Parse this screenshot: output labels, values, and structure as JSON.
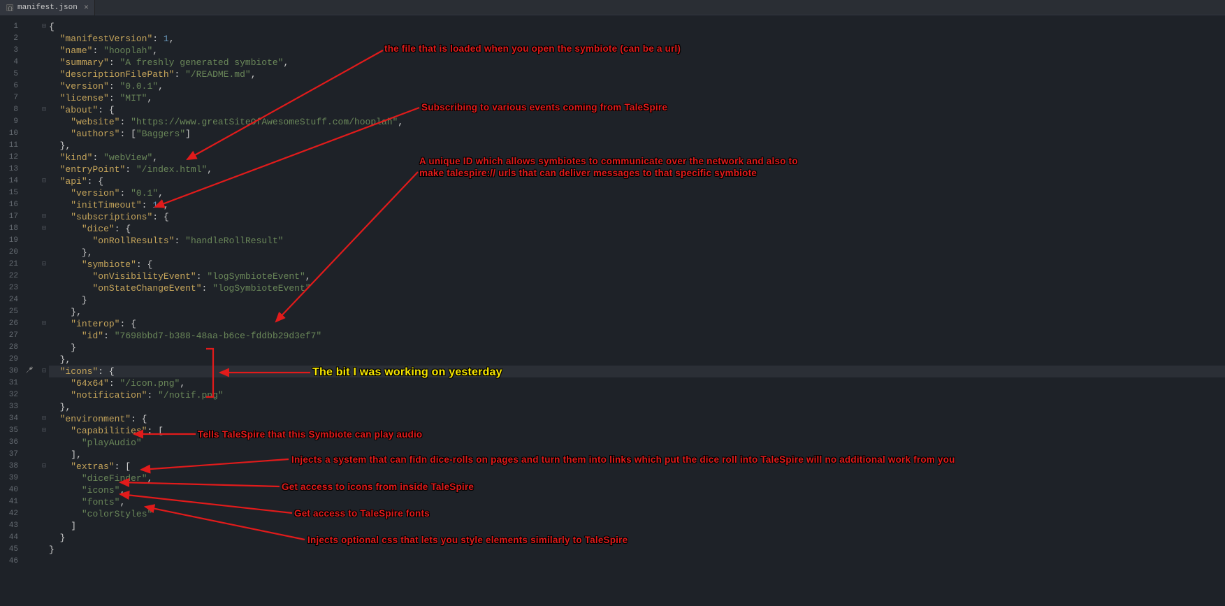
{
  "tab": {
    "filename": "manifest.json"
  },
  "current_line": 30,
  "lines": [
    {
      "n": 1,
      "t": "{"
    },
    {
      "n": 2,
      "t": "  \"manifestVersion\": 1,"
    },
    {
      "n": 3,
      "t": "  \"name\": \"hooplah\","
    },
    {
      "n": 4,
      "t": "  \"summary\": \"A freshly generated symbiote\","
    },
    {
      "n": 5,
      "t": "  \"descriptionFilePath\": \"/README.md\","
    },
    {
      "n": 6,
      "t": "  \"version\": \"0.0.1\","
    },
    {
      "n": 7,
      "t": "  \"license\": \"MIT\","
    },
    {
      "n": 8,
      "t": "  \"about\": {"
    },
    {
      "n": 9,
      "t": "    \"website\": \"https://www.greatSiteOfAwesomeStuff.com/hooplah\","
    },
    {
      "n": 10,
      "t": "    \"authors\": [\"Baggers\"]"
    },
    {
      "n": 11,
      "t": "  },"
    },
    {
      "n": 12,
      "t": "  \"kind\": \"webView\","
    },
    {
      "n": 13,
      "t": "  \"entryPoint\": \"/index.html\","
    },
    {
      "n": 14,
      "t": "  \"api\": {"
    },
    {
      "n": 15,
      "t": "    \"version\": \"0.1\","
    },
    {
      "n": 16,
      "t": "    \"initTimeout\": 10,"
    },
    {
      "n": 17,
      "t": "    \"subscriptions\": {"
    },
    {
      "n": 18,
      "t": "      \"dice\": {"
    },
    {
      "n": 19,
      "t": "        \"onRollResults\": \"handleRollResult\""
    },
    {
      "n": 20,
      "t": "      },"
    },
    {
      "n": 21,
      "t": "      \"symbiote\": {"
    },
    {
      "n": 22,
      "t": "        \"onVisibilityEvent\": \"logSymbioteEvent\","
    },
    {
      "n": 23,
      "t": "        \"onStateChangeEvent\": \"logSymbioteEvent\""
    },
    {
      "n": 24,
      "t": "      }"
    },
    {
      "n": 25,
      "t": "    },"
    },
    {
      "n": 26,
      "t": "    \"interop\": {"
    },
    {
      "n": 27,
      "t": "      \"id\": \"7698bbd7-b388-48aa-b6ce-fddbb29d3ef7\""
    },
    {
      "n": 28,
      "t": "    }"
    },
    {
      "n": 29,
      "t": "  },"
    },
    {
      "n": 30,
      "t": "  \"icons\": {"
    },
    {
      "n": 31,
      "t": "    \"64x64\": \"/icon.png\","
    },
    {
      "n": 32,
      "t": "    \"notification\": \"/notif.png\""
    },
    {
      "n": 33,
      "t": "  },"
    },
    {
      "n": 34,
      "t": "  \"environment\": {"
    },
    {
      "n": 35,
      "t": "    \"capabilities\": ["
    },
    {
      "n": 36,
      "t": "      \"playAudio\""
    },
    {
      "n": 37,
      "t": "    ],"
    },
    {
      "n": 38,
      "t": "    \"extras\": ["
    },
    {
      "n": 39,
      "t": "      \"diceFinder\","
    },
    {
      "n": 40,
      "t": "      \"icons\","
    },
    {
      "n": 41,
      "t": "      \"fonts\","
    },
    {
      "n": 42,
      "t": "      \"colorStyles\""
    },
    {
      "n": 43,
      "t": "    ]"
    },
    {
      "n": 44,
      "t": "  }"
    },
    {
      "n": 45,
      "t": "}"
    },
    {
      "n": 46,
      "t": ""
    }
  ],
  "fold_markers_at": [
    1,
    8,
    14,
    17,
    18,
    21,
    26,
    30,
    34,
    35,
    38
  ],
  "annotations": {
    "a1": "the file that is loaded when you open the symbiote (can be a url)",
    "a2": "Subscribing to various events coming from TaleSpire",
    "a3a": "A unique ID which allows symbiotes to communicate over the network and also to",
    "a3b": "make talespire:// urls that can deliver messages to that specific symbiote",
    "a4": "The bit I was working on yesterday",
    "a5": "Tells TaleSpire that this Symbiote can play audio",
    "a6": "Injects a system that can fidn dice-rolls on pages and turn them into links which put the dice roll into TaleSpire will no additional work from you",
    "a7": "Get access to icons from inside TaleSpire",
    "a8": "Get access to TaleSpire fonts",
    "a9": "Injects optional css that lets you style elements similarly to TaleSpire"
  }
}
